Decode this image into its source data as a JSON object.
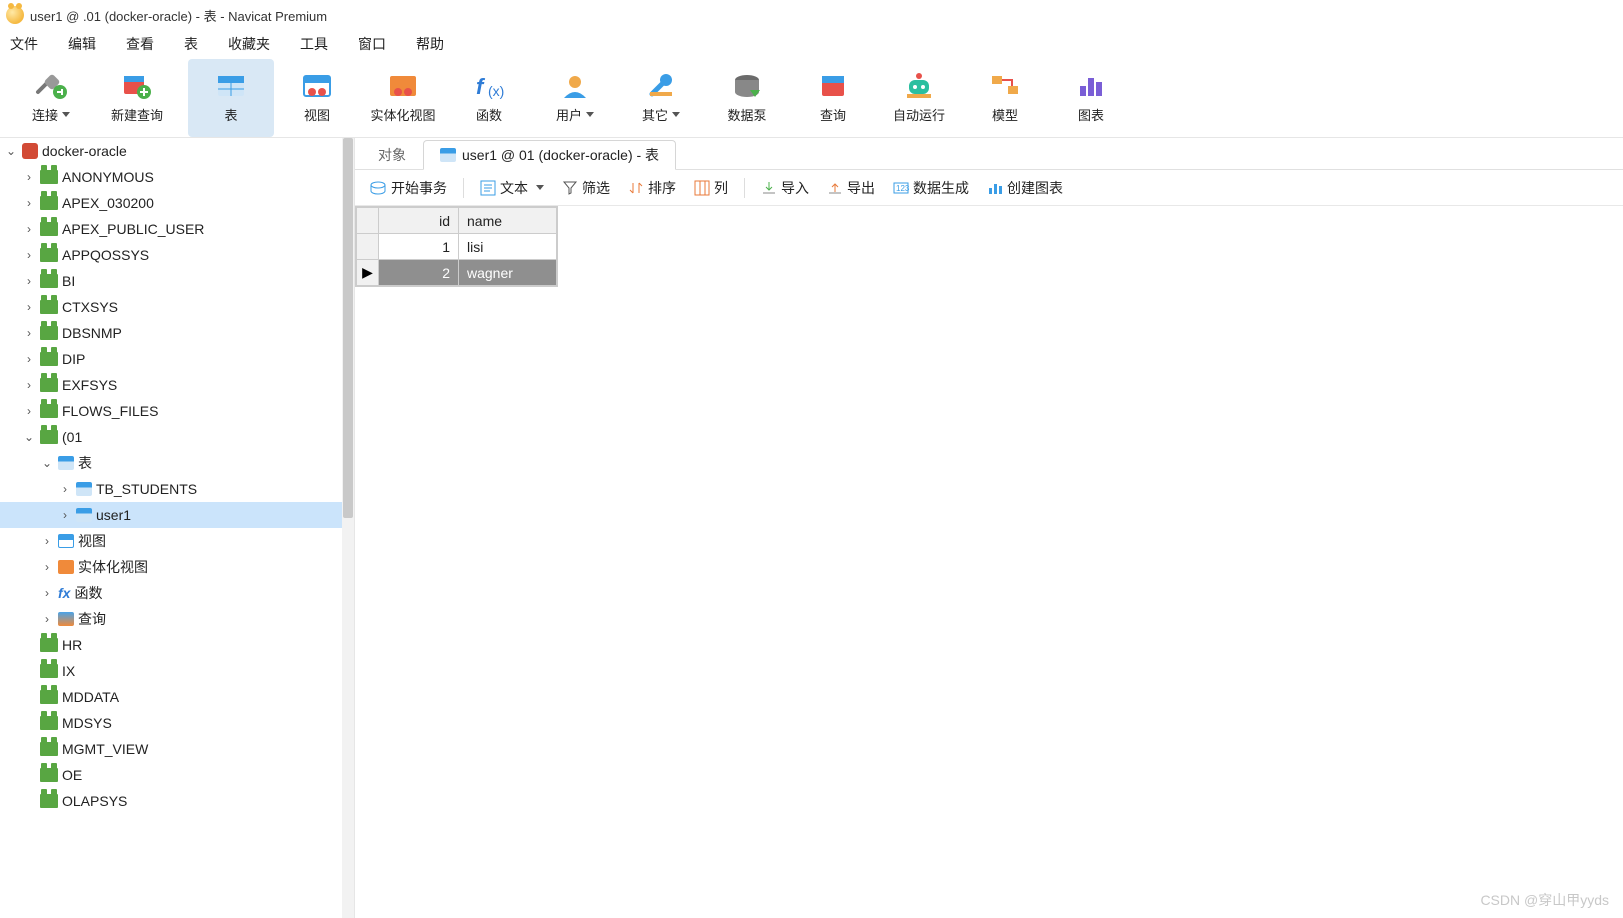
{
  "window": {
    "title": "user1 @   .01 (docker-oracle) - 表 - Navicat Premium"
  },
  "menu": {
    "items": [
      "文件",
      "编辑",
      "查看",
      "表",
      "收藏夹",
      "工具",
      "窗口",
      "帮助"
    ]
  },
  "toolbar": {
    "items": [
      {
        "label": "连接",
        "name": "connect"
      },
      {
        "label": "新建查询",
        "name": "new-query"
      },
      {
        "label": "表",
        "name": "tables",
        "active": true
      },
      {
        "label": "视图",
        "name": "views"
      },
      {
        "label": "实体化视图",
        "name": "mat-views"
      },
      {
        "label": "函数",
        "name": "functions"
      },
      {
        "label": "用户",
        "name": "users"
      },
      {
        "label": "其它",
        "name": "others"
      },
      {
        "label": "数据泵",
        "name": "data-pump"
      },
      {
        "label": "查询",
        "name": "query"
      },
      {
        "label": "自动运行",
        "name": "automation"
      },
      {
        "label": "模型",
        "name": "model"
      },
      {
        "label": "图表",
        "name": "charts"
      }
    ]
  },
  "sidebar": {
    "root": {
      "label": "docker-oracle"
    },
    "schemas1": [
      "ANONYMOUS",
      "APEX_030200",
      "APEX_PUBLIC_USER",
      "APPQOSSYS",
      "BI",
      "CTXSYS",
      "DBSNMP",
      "DIP",
      "EXFSYS",
      "FLOWS_FILES"
    ],
    "active_schema": "(01",
    "tables_label": "表",
    "tables": [
      "TB_STUDENTS",
      "user1"
    ],
    "folders": [
      {
        "label": "视图",
        "type": "view"
      },
      {
        "label": "实体化视图",
        "type": "mview"
      },
      {
        "label": "函数",
        "type": "func"
      },
      {
        "label": "查询",
        "type": "query"
      }
    ],
    "schemas2": [
      "HR",
      "IX",
      "MDDATA",
      "MDSYS",
      "MGMT_VIEW",
      "OE",
      "OLAPSYS"
    ]
  },
  "tabs": {
    "items": [
      {
        "label": "对象",
        "active": false
      },
      {
        "label": "user1 @   01 (docker-oracle) - 表",
        "active": true
      }
    ]
  },
  "subtoolbar": {
    "begin_tx": "开始事务",
    "text": "文本",
    "filter": "筛选",
    "sort": "排序",
    "columns": "列",
    "import": "导入",
    "export": "导出",
    "datagen": "数据生成",
    "chart": "创建图表"
  },
  "grid": {
    "columns": [
      "id",
      "name"
    ],
    "rows": [
      {
        "id": "1",
        "name": "lisi",
        "selected": false
      },
      {
        "id": "2",
        "name": "wagner",
        "selected": true
      }
    ]
  },
  "watermark": "CSDN @穿山甲yyds"
}
